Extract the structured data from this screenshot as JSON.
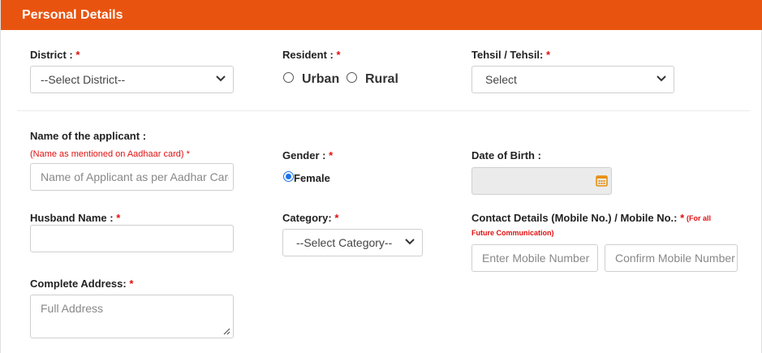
{
  "header": {
    "title": "Personal Details"
  },
  "district": {
    "label": "District :",
    "required": "*",
    "value": "--Select District--"
  },
  "resident": {
    "label": "Resident :",
    "required": "*",
    "options": [
      "Urban",
      "Rural"
    ]
  },
  "tehsil": {
    "label": "Tehsil / Tehsil:",
    "required": "*",
    "value": "Select"
  },
  "applicant": {
    "label": "Name of the applicant :",
    "note": "(Name as mentioned on Aadhaar card)",
    "required": "*",
    "placeholder": "Name of Applicant as per Aadhar Card"
  },
  "gender": {
    "label": "Gender :",
    "required": "*",
    "option": "Female",
    "selected": true
  },
  "dob": {
    "label": "Date of Birth :",
    "value": ""
  },
  "husband": {
    "label": "Husband Name :",
    "required": "*",
    "value": ""
  },
  "category": {
    "label": "Category:",
    "required": "*",
    "value": "--Select Category--"
  },
  "contact": {
    "label": "Contact Details (Mobile No.) / Mobile No.:",
    "required": "*",
    "note_line1": "(For all",
    "note_line2": "Future Communication)",
    "mobile_placeholder": "Enter Mobile Number",
    "confirm_placeholder": "Confirm Mobile Number"
  },
  "address": {
    "label": "Complete Address:",
    "required": "*",
    "placeholder": "Full Address"
  },
  "colors": {
    "header": "#e8540f",
    "required": "#e01010",
    "radio_checked": "#1a73e8",
    "calendar": "#e8900f"
  },
  "icons": {
    "select_arrow": "chevron-down-icon",
    "date": "calendar-icon",
    "resize": "resize-grip-icon"
  }
}
